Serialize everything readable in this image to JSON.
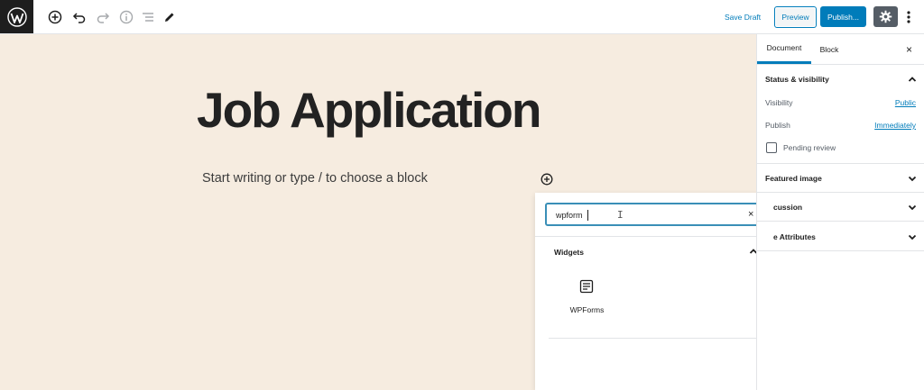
{
  "toolbar": {
    "save_draft": "Save Draft",
    "preview": "Preview",
    "publish": "Publish..."
  },
  "editor": {
    "title": "Job Application",
    "placeholder": "Start writing or type / to choose a block"
  },
  "inserter": {
    "search_value": "wpform",
    "clear": "×",
    "category": "Widgets",
    "items": [
      {
        "label": "WPForms",
        "icon": "wpforms-icon"
      }
    ]
  },
  "sidebar": {
    "tabs": [
      "Document",
      "Block"
    ],
    "close": "×",
    "status_visibility": {
      "title": "Status & visibility",
      "visibility_label": "Visibility",
      "visibility_value": "Public",
      "publish_label": "Publish",
      "publish_value": "Immediately",
      "pending_label": "Pending review"
    },
    "panels": [
      "Featured image",
      "cussion",
      "e Attributes"
    ]
  },
  "colors": {
    "accent": "#007cba",
    "canvas": "#f6ece0",
    "dark": "#1e1e1e"
  }
}
